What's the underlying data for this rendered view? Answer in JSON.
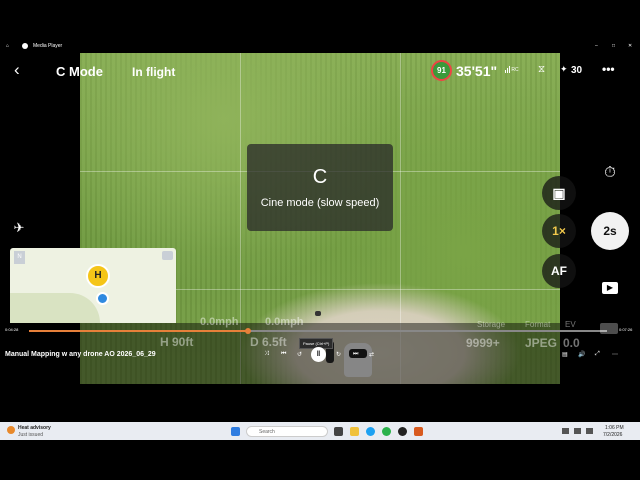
{
  "titlebar": {
    "app_title": "Media Player",
    "back_icon": "⌂",
    "minimize": "–",
    "maximize": "□",
    "close": "✕"
  },
  "hud": {
    "mode": "C Mode",
    "flight_status": "In flight",
    "battery": "91",
    "flight_time": "35'51\"",
    "rc_label": "RC",
    "satellites": "30",
    "more": "•••",
    "mode_box_letter": "C",
    "mode_box_text": "Cine mode (slow speed)",
    "zoom_label": "1×",
    "af_label": "AF",
    "shutter_label": "2s",
    "speed_h": "0.0mph",
    "speed_v": "0.0mph",
    "height": "H 90ft",
    "distance": "D 6.5ft",
    "storage_label": "Storage",
    "storage_value": "9999+",
    "format_label": "Format",
    "format_value": "JPEG",
    "ev_label": "EV",
    "ev_value": "0.0"
  },
  "map": {
    "home_marker": "H",
    "north_label": "N"
  },
  "player": {
    "time_current": "0:04:28",
    "time_total": "0:07:26",
    "progress": 0.379,
    "video_title": "Manual Mapping w any drone  AO 2026_06_29",
    "tooltip": "Pause (Ctrl+P)"
  },
  "taskbar": {
    "weather_title": "Heat advisory",
    "weather_sub": "Just issued",
    "search_placeholder": "Search",
    "time": "1:06 PM",
    "date": "7/2/2026"
  },
  "colors": {
    "accent": "#e6803a",
    "battery_green": "#3a9a3a",
    "zoom_yellow": "#f2c94c",
    "home_yellow": "#f5c518"
  }
}
